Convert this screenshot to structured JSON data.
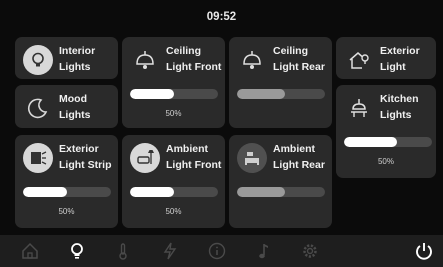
{
  "status": {
    "time": "09:52"
  },
  "tiles": {
    "interior": {
      "label": "Interior\nLights",
      "icon": "bulb-icon"
    },
    "mood": {
      "label": "Mood\nLights",
      "icon": "moon-icon"
    },
    "strip": {
      "label": "Exterior\nLight Strip",
      "icon": "light-strip-icon",
      "level": 0.5,
      "level_text": "50%"
    },
    "ceiling_front": {
      "label": "Ceiling\nLight Front",
      "icon": "ceiling-lamp-icon",
      "level": 0.5,
      "level_text": "50%"
    },
    "ambient_front": {
      "label": "Ambient\nLight Front",
      "icon": "armchair-lamp-icon",
      "level": 0.5,
      "level_text": "50%"
    },
    "ceiling_rear": {
      "label": "Ceiling\nLight Rear",
      "icon": "ceiling-lamp-icon",
      "level": 0.55
    },
    "ambient_rear": {
      "label": "Ambient\nLight Rear",
      "icon": "bed-lamp-icon",
      "level": 0.55
    },
    "exterior": {
      "label": "Exterior\nLight",
      "icon": "house-bulb-icon"
    },
    "kitchen": {
      "label": "Kitchen\nLights",
      "icon": "pendant-lamp-icon",
      "level": 0.6,
      "level_text": "50%"
    }
  },
  "nav": {
    "items": [
      "home-icon",
      "lightbulb-icon",
      "thermometer-icon",
      "lightning-icon",
      "info-icon",
      "music-note-icon",
      "gear-icon",
      "power-icon"
    ],
    "active": "lightbulb-icon"
  }
}
